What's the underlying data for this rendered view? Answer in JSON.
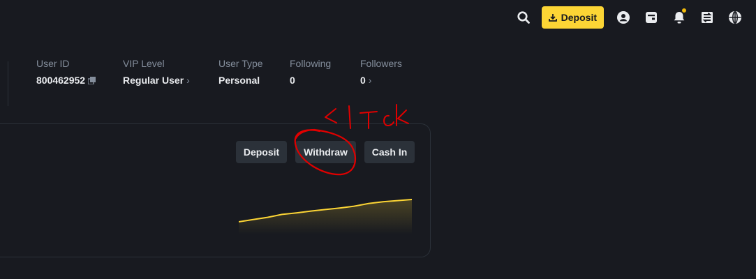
{
  "header": {
    "deposit_label": "Deposit",
    "icons": [
      "search-icon",
      "download-icon",
      "user-icon",
      "wallet-icon",
      "bell-icon",
      "transfer-icon",
      "globe-icon"
    ],
    "accent": "#fcd535",
    "notification_dot_color": "#f0b90b"
  },
  "profile": {
    "fields": [
      {
        "label": "User ID",
        "value": "800462952"
      },
      {
        "label": "VIP Level",
        "value": "Regular User"
      },
      {
        "label": "User Type",
        "value": "Personal"
      },
      {
        "label": "Following",
        "value": "0"
      },
      {
        "label": "Followers",
        "value": "0"
      }
    ]
  },
  "actions": {
    "deposit": "Deposit",
    "withdraw": "Withdraw",
    "cash_in": "Cash In"
  },
  "annotation": {
    "text": "click",
    "color": "#e00000"
  },
  "sparkline": {
    "color": "#fcd535",
    "values": [
      0,
      0.1,
      0.2,
      0.33,
      0.4,
      0.48,
      0.55,
      0.62,
      0.7,
      0.82,
      0.9,
      0.95,
      1
    ]
  }
}
